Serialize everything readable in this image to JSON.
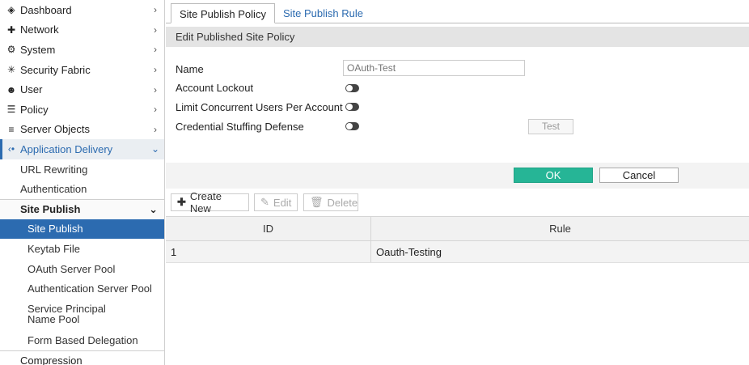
{
  "sidebar": {
    "items": [
      {
        "label": "Dashboard",
        "icon": "dashboard-icon",
        "glyph": "◈"
      },
      {
        "label": "Network",
        "icon": "network-icon",
        "glyph": "✚"
      },
      {
        "label": "System",
        "icon": "gear-icon",
        "glyph": "⚙"
      },
      {
        "label": "Security Fabric",
        "icon": "security-fabric-icon",
        "glyph": "✳"
      },
      {
        "label": "User",
        "icon": "user-icon",
        "glyph": "☻"
      },
      {
        "label": "Policy",
        "icon": "policy-icon",
        "glyph": "☰"
      },
      {
        "label": "Server Objects",
        "icon": "server-icon",
        "glyph": "≡"
      },
      {
        "label": "Application Delivery",
        "icon": "application-delivery-icon",
        "glyph": "‹•"
      }
    ],
    "app_delivery_sub": [
      "URL Rewriting",
      "Authentication"
    ],
    "site_publish_header": "Site Publish",
    "site_publish_sub": [
      "Site Publish",
      "Keytab File",
      "OAuth Server Pool",
      "Authentication Server Pool",
      "Service Principal Name Pool",
      "Form Based Delegation"
    ],
    "bottom_item": "Compression"
  },
  "tabs": [
    "Site Publish Policy",
    "Site Publish Rule"
  ],
  "section_title": "Edit Published Site Policy",
  "form": {
    "name_label": "Name",
    "name_placeholder": "OAuth-Test",
    "account_lockout_label": "Account Lockout",
    "limit_concurrent_label": "Limit Concurrent Users Per Account",
    "credential_stuffing_label": "Credential Stuffing Defense",
    "test_button": "Test",
    "toggles": {
      "account_lockout": false,
      "limit_concurrent": false,
      "credential_stuffing": false
    }
  },
  "buttons": {
    "ok": "OK",
    "cancel": "Cancel"
  },
  "toolbar": {
    "create_new": "Create New",
    "edit": "Edit",
    "delete": "Delete"
  },
  "table": {
    "columns": [
      "ID",
      "Rule"
    ],
    "rows": [
      {
        "id": "1",
        "rule": "Oauth-Testing"
      }
    ]
  },
  "colors": {
    "accent": "#2c6bb0",
    "ok_button": "#26b596"
  }
}
